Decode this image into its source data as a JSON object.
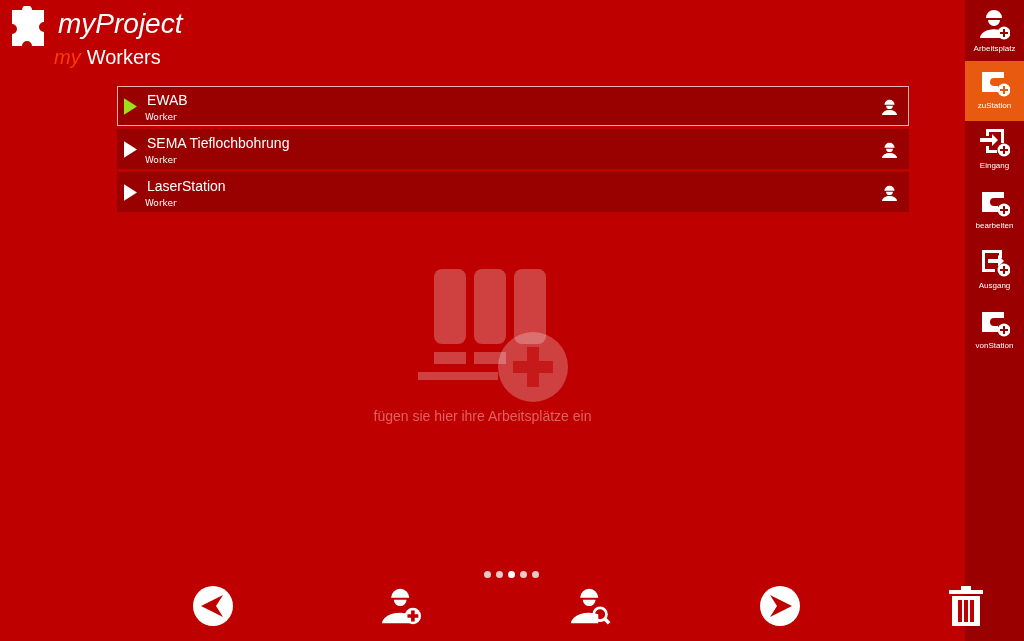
{
  "app_title": "myProject",
  "page_title": {
    "prefix": "my",
    "name": "Workers"
  },
  "workers": [
    {
      "name": "EWAB",
      "type": "Worker",
      "selected": true
    },
    {
      "name": "SEMA Tieflochbohrung",
      "type": "Worker",
      "selected": false
    },
    {
      "name": "LaserStation",
      "type": "Worker",
      "selected": false
    }
  ],
  "empty_hint": "fügen sie hier ihre Arbeitsplätze ein",
  "pager": [
    {
      "selected": false
    },
    {
      "selected": false
    },
    {
      "selected": true
    },
    {
      "selected": false
    },
    {
      "selected": false
    }
  ],
  "sidebar": [
    {
      "label": "Arbeitsplatz",
      "kind": "worker",
      "selected": false
    },
    {
      "label": "zuStation",
      "kind": "station",
      "selected": true
    },
    {
      "label": "Eingang",
      "kind": "input",
      "selected": false
    },
    {
      "label": "bearbeiten",
      "kind": "station",
      "selected": false
    },
    {
      "label": "Ausgang",
      "kind": "output",
      "selected": false
    },
    {
      "label": "vonStation",
      "kind": "station",
      "selected": false
    }
  ]
}
